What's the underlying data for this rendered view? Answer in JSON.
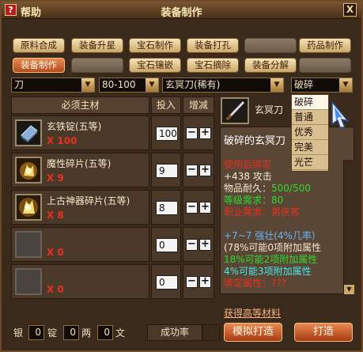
{
  "window": {
    "help_label": "帮助",
    "title": "装备制作",
    "help_icon_text": "?",
    "close_glyph": "X"
  },
  "tabs": [
    {
      "label": "原料合成",
      "state": "normal"
    },
    {
      "label": "装备升星",
      "state": "normal"
    },
    {
      "label": "宝石制作",
      "state": "normal"
    },
    {
      "label": "装备打孔",
      "state": "normal"
    },
    {
      "label": "",
      "state": "disabled"
    },
    {
      "label": "药品制作",
      "state": "normal"
    },
    {
      "label": "装备制作",
      "state": "active"
    },
    {
      "label": "",
      "state": "disabled"
    },
    {
      "label": "宝石镶嵌",
      "state": "normal"
    },
    {
      "label": "宝石摘除",
      "state": "normal"
    },
    {
      "label": "装备分解",
      "state": "normal"
    },
    {
      "label": "",
      "state": "disabled"
    }
  ],
  "filters": {
    "type": "刀",
    "level": "80-100",
    "item": "玄冥刀(稀有)",
    "quality": "破碎"
  },
  "quality_options": [
    "破碎",
    "普通",
    "优秀",
    "完美",
    "光芒"
  ],
  "table": {
    "col_material": "必须主材",
    "col_input": "投入",
    "col_adjust": "增减"
  },
  "materials": [
    {
      "name": "玄铁锭(五等)",
      "qty": "X 100",
      "input": "100"
    },
    {
      "name": "魔性碎片(五等)",
      "qty": "X 9",
      "input": "9"
    },
    {
      "name": "上古神器碎片(五等)",
      "qty": "X 8",
      "input": "8"
    },
    {
      "name": "",
      "qty": "X 0",
      "input": "0"
    },
    {
      "name": "",
      "qty": "X 0",
      "input": "0"
    }
  ],
  "adjust": {
    "minus": "−",
    "plus": "+"
  },
  "item": {
    "short_name": "玄冥刀",
    "full_name": "破碎的玄冥刀",
    "bind": "使用后绑定",
    "attack": "+438 攻击",
    "durability_label": "物品耐久：",
    "durability": "500/500",
    "level_req": "等级需求：80",
    "class_req": "职业需求：男侠客",
    "enhance": "+7~7 强壮(4%几率)",
    "chance0": "(78%可能0项附加属性",
    "chance2": "18%可能2项附加属性",
    "chance3": "4%可能3项附加属性",
    "bind_attr": "绑定属性：???"
  },
  "bottom": {
    "material_link": "获得高等材料",
    "silver_label": "银",
    "ingot_value": "0",
    "ingot_label": "锭",
    "liang_value": "0",
    "liang_label": "两",
    "wen_value": "0",
    "wen_label": "文",
    "silver_value": "0",
    "rate_label": "成功率",
    "simulate_button": "模拟打造",
    "forge_button": "打造"
  },
  "colors": {
    "red": "#e83020",
    "green": "#30d830",
    "blue": "#6ab0f8",
    "cyan": "#48e8e8"
  },
  "icons": {
    "help": "question-icon",
    "close": "close-icon",
    "dropdown": "chevron-down-icon",
    "cursor": "pointer-cursor-icon"
  }
}
